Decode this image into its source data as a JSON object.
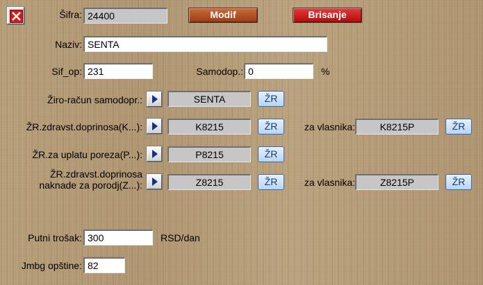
{
  "header": {
    "close_icon": "close-x-icon",
    "sifra_label": "Šifra:",
    "sifra_value": "24400",
    "modif_label": "Modif",
    "brisanje_label": "Brisanje"
  },
  "naziv": {
    "label": "Naziv:",
    "value": "SENTA"
  },
  "sif_op": {
    "label": "Sif_op:",
    "value": "231"
  },
  "samodop": {
    "label": "Samodop.:",
    "value": "0",
    "unit": "%"
  },
  "zr_samodopr": {
    "label": "Žiro-račun samodopr.:",
    "value": "SENTA",
    "zr_label": "ŽR",
    "arrow_icon": "play-arrow-icon"
  },
  "zr_zdravst": {
    "label": "ŽR.zdravst.doprinosa(K...):",
    "value": "K8215",
    "zr_label": "ŽR",
    "owner_label": "za vlasnika:",
    "owner_value": "K8215P",
    "owner_zr_label": "ŽR",
    "arrow_icon": "play-arrow-icon"
  },
  "zr_porez": {
    "label": "ŽR.za uplatu poreza(P...):",
    "value": "P8215",
    "zr_label": "ŽR",
    "arrow_icon": "play-arrow-icon"
  },
  "zr_porodj": {
    "label_line1": "ŽR.zdravst.doprinosa",
    "label_line2": "naknade za porodj(Z...):",
    "value": "Z8215",
    "zr_label": "ŽR",
    "owner_label": "za vlasnika:",
    "owner_value": "Z8215P",
    "owner_zr_label": "ŽR",
    "arrow_icon": "play-arrow-icon"
  },
  "putni": {
    "label": "Putni trošak:",
    "value": "300",
    "unit": "RSD/dan"
  },
  "jmbg": {
    "label": "Jmbg opštine:",
    "value": "82"
  },
  "colors": {
    "background": "#b39a76",
    "modif_button": "#b0512a",
    "brisanje_button": "#cc1f1f",
    "zr_button": "#c9dcf5",
    "close_button": "#d61a1a"
  }
}
